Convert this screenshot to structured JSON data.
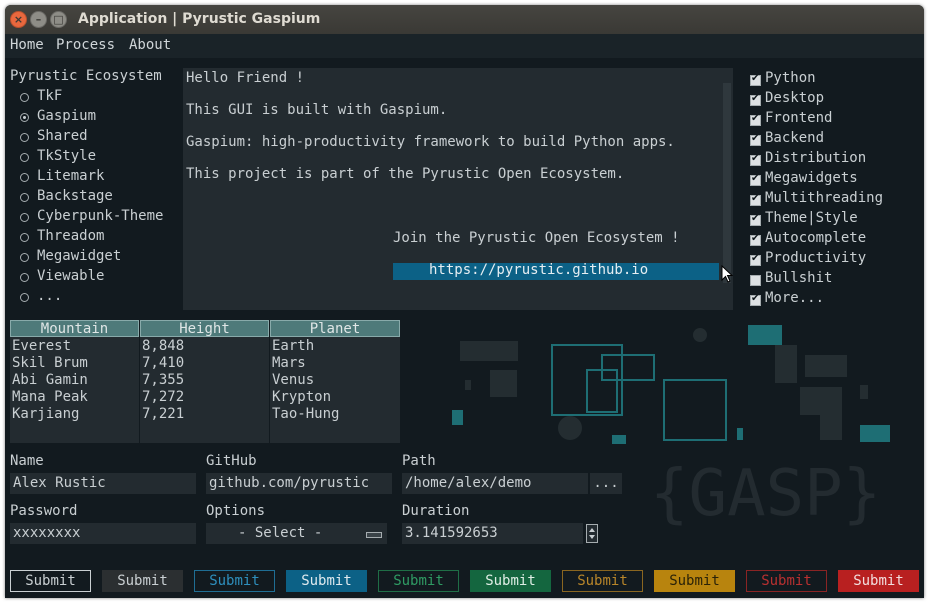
{
  "window": {
    "title": "Application | Pyrustic Gaspium"
  },
  "menu": [
    "Home",
    "Process",
    "About"
  ],
  "ecosystem": {
    "title": "Pyrustic Ecosystem",
    "selected": "Gaspium",
    "items": [
      "TkF",
      "Gaspium",
      "Shared",
      "TkStyle",
      "Litemark",
      "Backstage",
      "Cyberpunk-Theme",
      "Threadom",
      "Megawidget",
      "Viewable",
      "..."
    ]
  },
  "text": {
    "line1": "Hello Friend !",
    "line2": "This GUI is built with Gaspium.",
    "line3": "Gaspium: high-productivity framework to build Python apps.",
    "line4": "This project is part of the Pyrustic Open Ecosystem.",
    "join": "Join the Pyrustic Open Ecosystem !",
    "link": "https://pyrustic.github.io"
  },
  "checks": [
    {
      "label": "Python",
      "checked": true
    },
    {
      "label": "Desktop",
      "checked": true
    },
    {
      "label": "Frontend",
      "checked": true
    },
    {
      "label": "Backend",
      "checked": true
    },
    {
      "label": "Distribution",
      "checked": true
    },
    {
      "label": "Megawidgets",
      "checked": true
    },
    {
      "label": "Multithreading",
      "checked": true
    },
    {
      "label": "Theme|Style",
      "checked": true
    },
    {
      "label": "Autocomplete",
      "checked": true
    },
    {
      "label": "Productivity",
      "checked": true
    },
    {
      "label": "Bullshit",
      "checked": false
    },
    {
      "label": "More...",
      "checked": true
    }
  ],
  "table": {
    "columns": [
      "Mountain",
      "Height",
      "Planet"
    ],
    "rows": [
      [
        "Everest",
        "8,848",
        "Earth"
      ],
      [
        "Skil Brum",
        "7,410",
        "Mars"
      ],
      [
        "Abi Gamin",
        "7,355",
        "Venus"
      ],
      [
        "Mana Peak",
        "7,272",
        "Krypton"
      ],
      [
        "Karjiang",
        "7,221",
        "Tao-Hung"
      ]
    ]
  },
  "form": {
    "name_label": "Name",
    "name_value": "Alex Rustic",
    "github_label": "GitHub",
    "github_value": "github.com/pyrustic",
    "path_label": "Path",
    "path_value": "/home/alex/demo",
    "path_browse": "...",
    "password_label": "Password",
    "password_value": "xxxxxxxx",
    "options_label": "Options",
    "options_value": "- Select -",
    "duration_label": "Duration",
    "duration_value": "3.141592653"
  },
  "logo_text": "{GASP}",
  "buttons": [
    {
      "label": "Submit",
      "bg": "#121a1f",
      "fg": "#c9cfd2",
      "border": "#c9cfd2"
    },
    {
      "label": "Submit",
      "bg": "#2b2f31",
      "fg": "#c9cfd2",
      "border": "#2b2f31"
    },
    {
      "label": "Submit",
      "bg": "#121a1f",
      "fg": "#2e8fbd",
      "border": "#1f6e94"
    },
    {
      "label": "Submit",
      "bg": "#0c6186",
      "fg": "#dfe9ee",
      "border": "#0c6186"
    },
    {
      "label": "Submit",
      "bg": "#121a1f",
      "fg": "#2f9b63",
      "border": "#1f6e46"
    },
    {
      "label": "Submit",
      "bg": "#14663f",
      "fg": "#dfeee5",
      "border": "#14663f"
    },
    {
      "label": "Submit",
      "bg": "#121a1f",
      "fg": "#b8862a",
      "border": "#8a6620"
    },
    {
      "label": "Submit",
      "bg": "#b8840e",
      "fg": "#2a2208",
      "border": "#b8840e"
    },
    {
      "label": "Submit",
      "bg": "#121a1f",
      "fg": "#b83030",
      "border": "#8a2424"
    },
    {
      "label": "Submit",
      "bg": "#b82020",
      "fg": "#f2dede",
      "border": "#b82020"
    }
  ]
}
